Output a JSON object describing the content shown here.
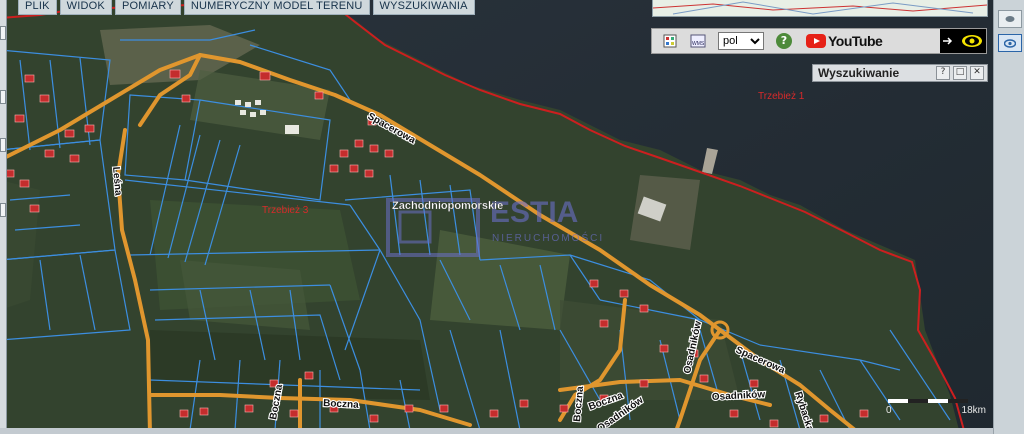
{
  "menu": {
    "items": [
      {
        "label": "PLIK"
      },
      {
        "label": "WIDOK"
      },
      {
        "label": "POMIARY"
      },
      {
        "label": "NUMERYCZNY MODEL TERENU"
      },
      {
        "label": "WYSZUKIWANIA"
      }
    ]
  },
  "toolbar": {
    "language": "pol",
    "youtube_label": "YouTube",
    "help_label": "?"
  },
  "panel": {
    "title": "Wyszukiwanie",
    "help": "?",
    "maximize": "□",
    "close": "✕"
  },
  "map": {
    "region_label": "Zachodniopomorskie",
    "watermark_main": "ESTIA",
    "watermark_sub": "NIERUCHOMOŚCI",
    "area_labels": [
      "Trzebież 1",
      "Trzebież 3"
    ],
    "streets": [
      "Spacerowa",
      "Leśna",
      "Boczna",
      "Boczna",
      "Osadników",
      "Osadników",
      "Spacerowa",
      "Rybacka",
      "Osadników"
    ]
  },
  "scale": {
    "left": "0",
    "right": "18km"
  },
  "colors": {
    "parcel_lines": "#3c8ee0",
    "road": "#e0962e",
    "boundary": "#cc1f1f",
    "water": "#27323a",
    "forest": "#2e3f27"
  }
}
